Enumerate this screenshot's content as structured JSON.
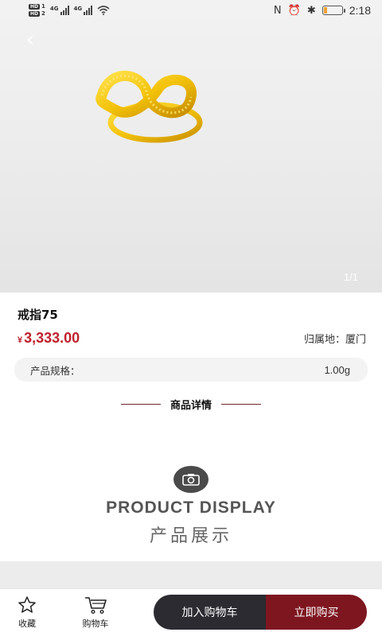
{
  "status_bar": {
    "hd1": "HD",
    "hd1_sub": "1",
    "hd2": "HD",
    "hd2_sub": "2",
    "network1": "4G",
    "network2": "4G",
    "nfc": "N",
    "alarm": "⏰",
    "bluetooth": "✱",
    "battery_level": 0.2,
    "time": "2:18"
  },
  "hero": {
    "image_counter": "1/1",
    "back_icon": "chevron-left-icon"
  },
  "product": {
    "name": "戒指75",
    "currency": "¥",
    "price": "3,333.00",
    "origin": "归属地：厦门",
    "spec_label": "产品规格：",
    "spec_value": "1.00g"
  },
  "details": {
    "title": "商品详情"
  },
  "display": {
    "title_en": "PRODUCT DISPLAY",
    "title_cn": "产品展示",
    "icon": "camera-icon"
  },
  "bottom_bar": {
    "favorite_label": "收藏",
    "cart_label": "购物车",
    "add_to_cart": "加入购物车",
    "buy_now": "立即购买"
  },
  "colors": {
    "price": "#c0202d",
    "add_to_cart_bg": "#2b2b31",
    "buy_now_bg": "#7e1620",
    "ring_gold": "#f3c20a"
  }
}
